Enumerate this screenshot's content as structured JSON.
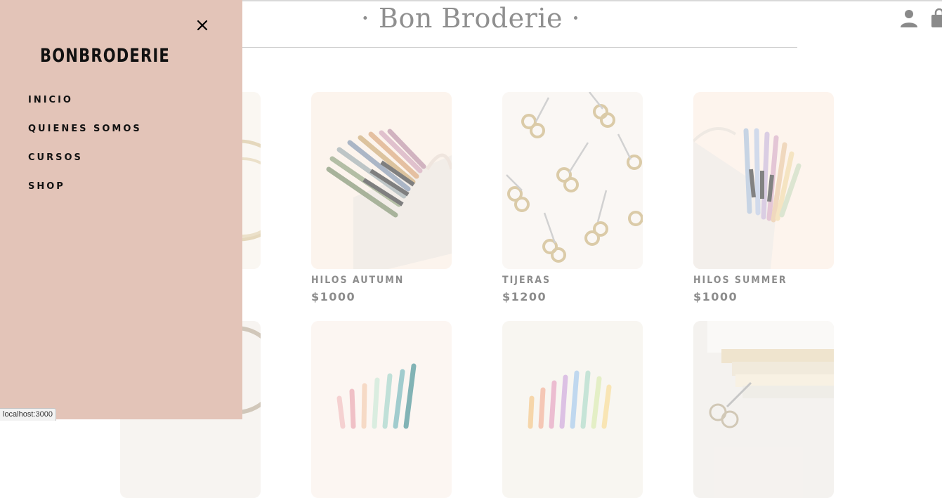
{
  "header": {
    "title": "· Bon Broderie ·",
    "icons": [
      "user-icon",
      "shopping-bag-icon"
    ]
  },
  "drawer": {
    "logo": "BONBRODERIE",
    "close_icon": "close-icon",
    "nav": [
      "INICIO",
      "QUIENES SOMOS",
      "CURSOS",
      "SHOP"
    ]
  },
  "products": [
    {
      "name": "HILOS AUTUMN",
      "price": "$1000"
    },
    {
      "name": "TIJERAS",
      "price": "$1200"
    },
    {
      "name": "HILOS SUMMER",
      "price": "$1000"
    }
  ],
  "status_bar": "localhost:3000",
  "colors": {
    "drawer_bg": "#e3c4b8",
    "muted_text": "#8c8c8c"
  }
}
